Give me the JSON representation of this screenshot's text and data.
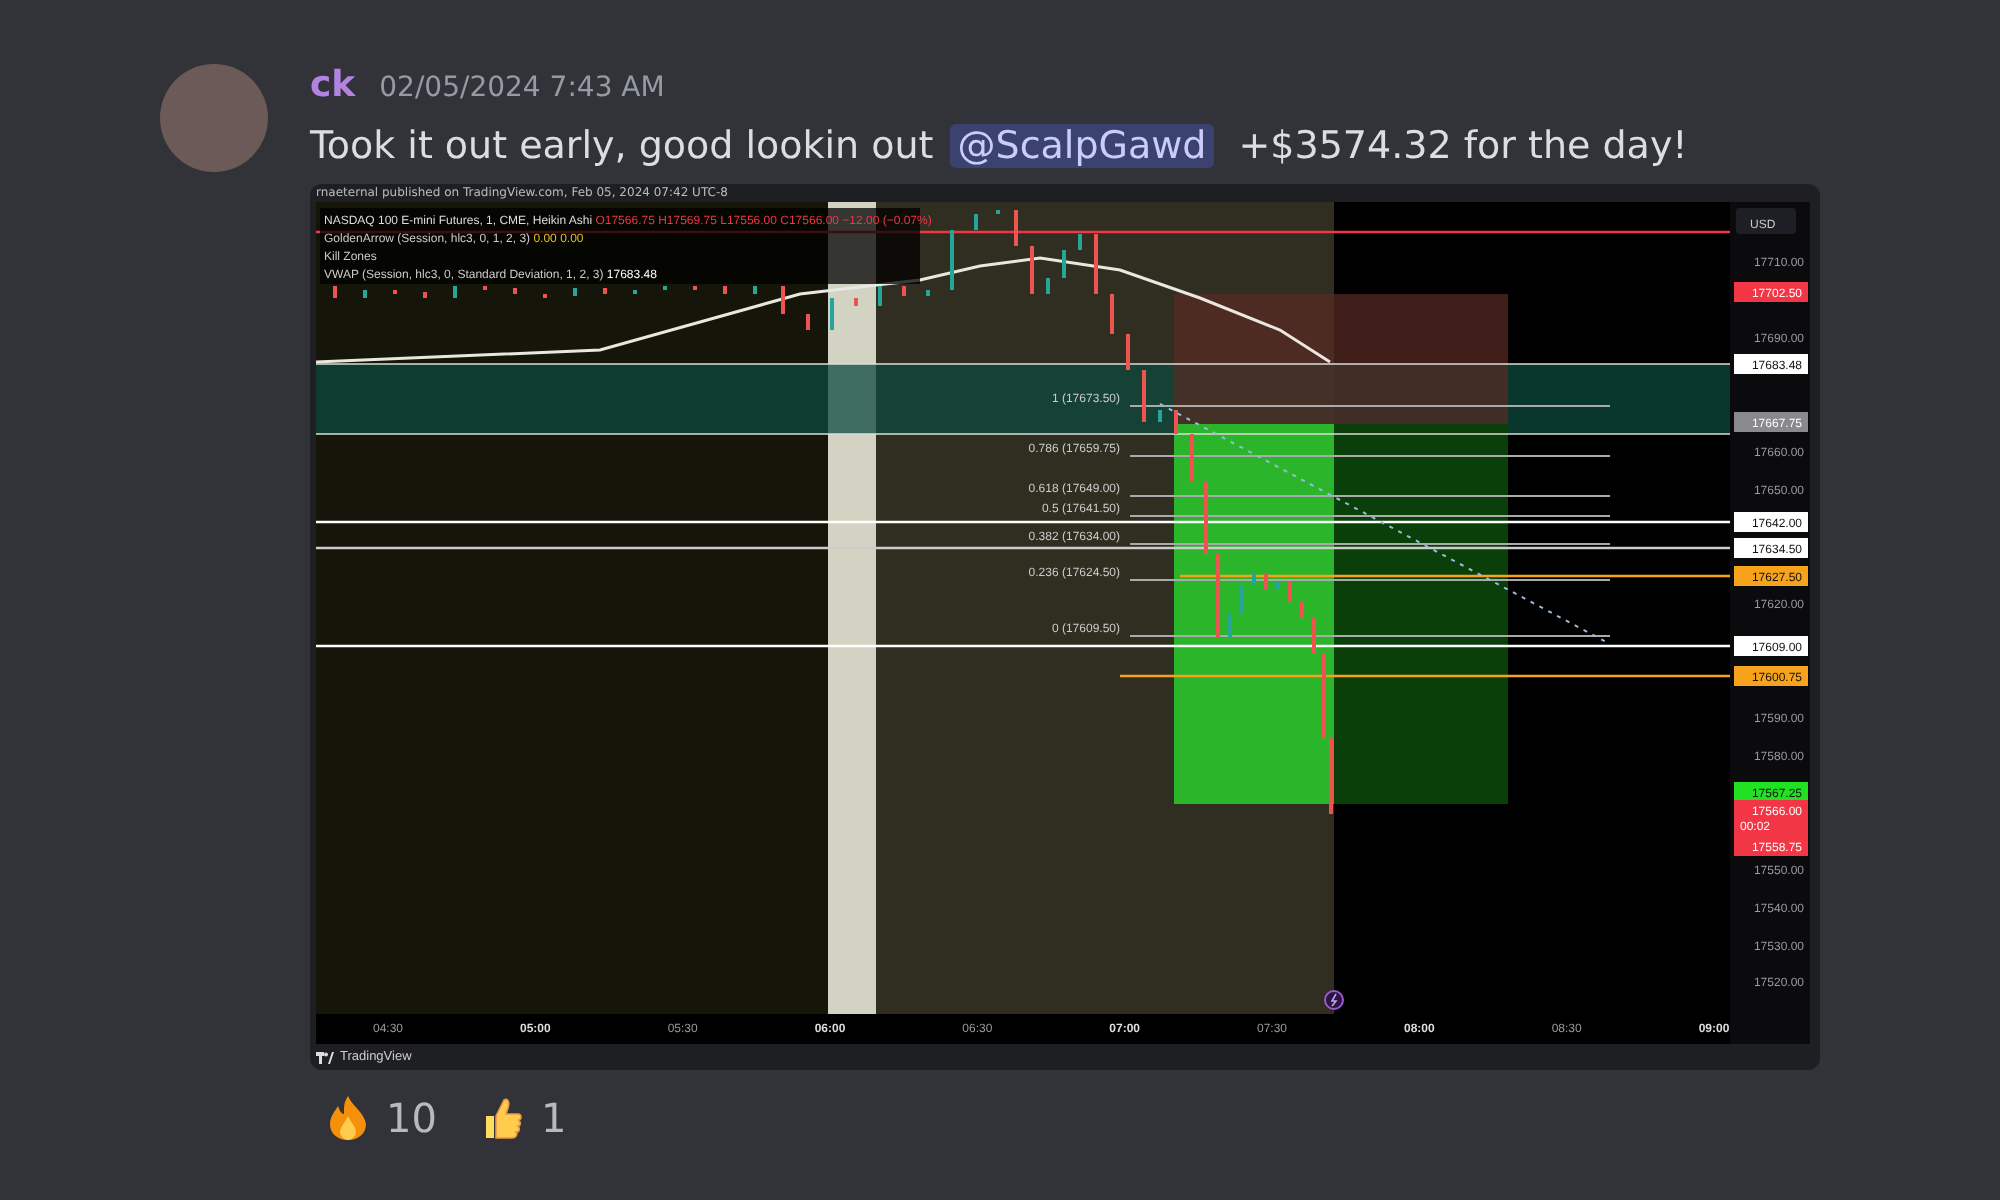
{
  "message": {
    "author": "ck",
    "timestamp": "02/05/2024 7:43 AM",
    "text_before": "Took it out early, good lookin out",
    "mention": "@ScalpGawd",
    "text_after": "+$3574.32 for the day!"
  },
  "attachment": {
    "header": "rnaeternal published on TradingView.com, Feb 05, 2024 07:42 UTC-8",
    "legend": {
      "symbol": "NASDAQ 100 E-mini Futures, 1, CME, Heikin Ashi",
      "ohlc": "O17566.75 H17569.75 L17556.00 C17566.00 −12.00 (−0.07%)",
      "indicator": "GoldenArrow (Session, hlc3, 0, 1, 2, 3)",
      "indicator_values": "0.00  0.00",
      "zones": "Kill Zones",
      "vwap": "VWAP (Session, hlc3, 0, Standard Deviation, 1, 2, 3)",
      "vwap_value": "17683.48"
    },
    "currency": "USD",
    "fib_levels": [
      "1 (17673.50)",
      "0.786 (17659.75)",
      "0.618 (17649.00)",
      "0.5 (17641.50)",
      "0.382 (17634.00)",
      "0.236 (17624.50)",
      "0 (17609.50)"
    ],
    "price_ticks": [
      "17710.00",
      "17690.00",
      "17660.00",
      "17650.00",
      "17620.00",
      "17590.00",
      "17580.00",
      "17550.00",
      "17540.00",
      "17530.00",
      "17520.00"
    ],
    "price_tags": [
      {
        "label": "17702.50",
        "color": "#f23645"
      },
      {
        "label": "17683.48",
        "color": "#ffffff"
      },
      {
        "label": "17667.75",
        "color": "#8a8a8e"
      },
      {
        "label": "17642.00",
        "color": "#ffffff"
      },
      {
        "label": "17634.50",
        "color": "#ffffff"
      },
      {
        "label": "17627.50",
        "color": "#f7a21b"
      },
      {
        "label": "17609.00",
        "color": "#ffffff"
      },
      {
        "label": "17600.75",
        "color": "#f7a21b"
      },
      {
        "label": "17567.25",
        "color": "#22e022"
      },
      {
        "label": "17566.00",
        "color": "#f23645",
        "countdown": "00:02"
      },
      {
        "label": "17558.75",
        "color": "#f23645"
      }
    ],
    "time_ticks": [
      {
        "label": "04:30",
        "bold": false
      },
      {
        "label": "05:00",
        "bold": true
      },
      {
        "label": "05:30",
        "bold": false
      },
      {
        "label": "06:00",
        "bold": true
      },
      {
        "label": "06:30",
        "bold": false
      },
      {
        "label": "07:00",
        "bold": true
      },
      {
        "label": "07:30",
        "bold": false
      },
      {
        "label": "08:00",
        "bold": true
      },
      {
        "label": "08:30",
        "bold": false
      },
      {
        "label": "09:00",
        "bold": true
      }
    ],
    "footer": "TradingView"
  },
  "reactions": [
    {
      "kind": "fire",
      "count": "10"
    },
    {
      "kind": "thumbs-up",
      "count": "1"
    }
  ]
}
